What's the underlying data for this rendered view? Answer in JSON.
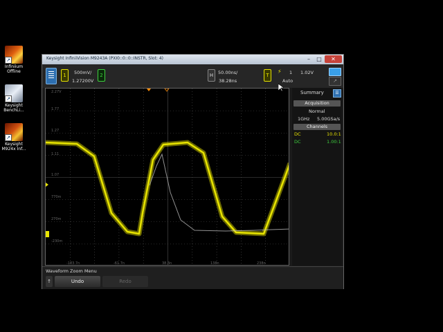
{
  "desktop": {
    "icons": [
      {
        "label": "Infiniium Offline",
        "icon": "infiniium-icon"
      },
      {
        "label": "Keysight BenchLi...",
        "icon": "benchvue-icon"
      },
      {
        "label": "Keysight M924x Inf...",
        "icon": "infiniivision-icon"
      }
    ]
  },
  "window": {
    "title": "Keysight InfiniiVision M9243A (PXI0::0::0::INSTR, Slot: 4)",
    "minimize": "–",
    "maximize": "□",
    "close": "✕"
  },
  "toolbar": {
    "channel1_scale": "500mV/",
    "channel1_offset": "1.27200V",
    "channel1_label": "1",
    "channel2_label": "2",
    "horizontal_label": "H",
    "timebase": "50.00ns/",
    "delay": "38.28ns",
    "trigger_label": "T",
    "trigger_source": "1",
    "trigger_level": "1.02V",
    "trigger_mode": "Auto"
  },
  "waveform_area": {
    "grid_labels_y": [
      "2.27V",
      "1.77",
      "1.27",
      "1.11",
      "1.07",
      "770m",
      "270m",
      "-230m"
    ],
    "grid_labels_x": [
      "-183.7n",
      "-61.7n",
      "38.3n",
      "138n",
      "238n"
    ],
    "colors": {
      "channel1": "#e8e400",
      "grid": "#555555",
      "reference_trace": "#b8b8b8",
      "trigger_marker": "#ff8c00"
    }
  },
  "sidebar": {
    "title": "Summary",
    "acquisition_header": "Acquisition",
    "acq_mode": "Normal",
    "bandwidth": "1GHz",
    "sample_rate": "5.00GSa/s",
    "channels_header": "Channels",
    "ch1_coupling": "DC",
    "ch1_probe": "10.0:1",
    "ch2_coupling": "DC",
    "ch2_probe": "1.00:1"
  },
  "bottom": {
    "menu_title": "Waveform Zoom Menu",
    "undo": "Undo",
    "redo": "Redo"
  }
}
